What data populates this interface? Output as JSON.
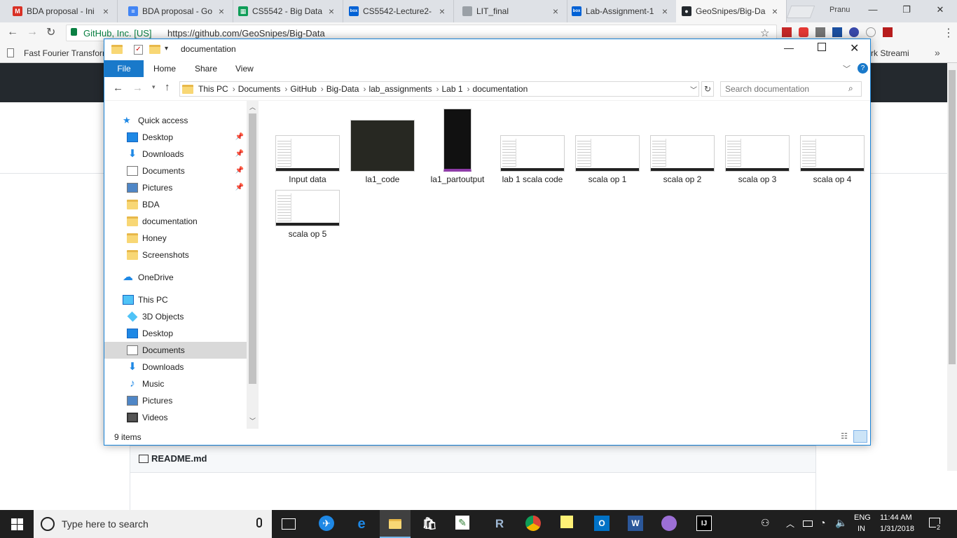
{
  "browser": {
    "tabs": [
      {
        "title": "BDA proposal - Ini",
        "color": "#d93025",
        "glyph": "M"
      },
      {
        "title": "BDA proposal - Go",
        "color": "#4285f4",
        "glyph": "≡"
      },
      {
        "title": "CS5542 - Big Data",
        "color": "#0f9d58",
        "glyph": "▦"
      },
      {
        "title": "CS5542-Lecture2-",
        "color": "#0061d5",
        "glyph": "box"
      },
      {
        "title": "LIT_final",
        "color": "#9aa0a6",
        "glyph": ""
      },
      {
        "title": "Lab-Assignment-1",
        "color": "#0061d5",
        "glyph": "box"
      },
      {
        "title": "GeoSnipes/Big-Da",
        "color": "#24292e",
        "glyph": "●"
      }
    ],
    "profile": "Pranu",
    "secure_label": "GitHub, Inc. [US]",
    "url": "https://github.com/GeoSnipes/Big-Data",
    "bookmark_left": "Fast Fourier Transforr",
    "bookmark_right": "rk Streami"
  },
  "explorer": {
    "title": "documentation",
    "ribbon_tabs": [
      "File",
      "Home",
      "Share",
      "View"
    ],
    "breadcrumb": [
      "This PC",
      "Documents",
      "GitHub",
      "Big-Data",
      "lab_assignments",
      "Lab 1",
      "documentation"
    ],
    "search_placeholder": "Search documentation",
    "nav": {
      "quick_access": "Quick access",
      "quick_items": [
        "Desktop",
        "Downloads",
        "Documents",
        "Pictures",
        "BDA",
        "documentation",
        "Honey",
        "Screenshots"
      ],
      "onedrive": "OneDrive",
      "this_pc": "This PC",
      "pc_items": [
        "3D Objects",
        "Desktop",
        "Documents",
        "Downloads",
        "Music",
        "Pictures",
        "Videos"
      ]
    },
    "files": [
      "Input data",
      "la1_code",
      "la1_partoutput",
      "lab 1 scala code",
      "scala op 1",
      "scala op 2",
      "scala op 3",
      "scala op 4",
      "scala op 5"
    ],
    "status": "9 items"
  },
  "github": {
    "readme": "README.md"
  },
  "taskbar": {
    "search_placeholder": "Type here to search",
    "lang_top": "ENG",
    "lang_bottom": "IN",
    "time": "11:44 AM",
    "date": "1/31/2018",
    "notification_count": "2"
  }
}
